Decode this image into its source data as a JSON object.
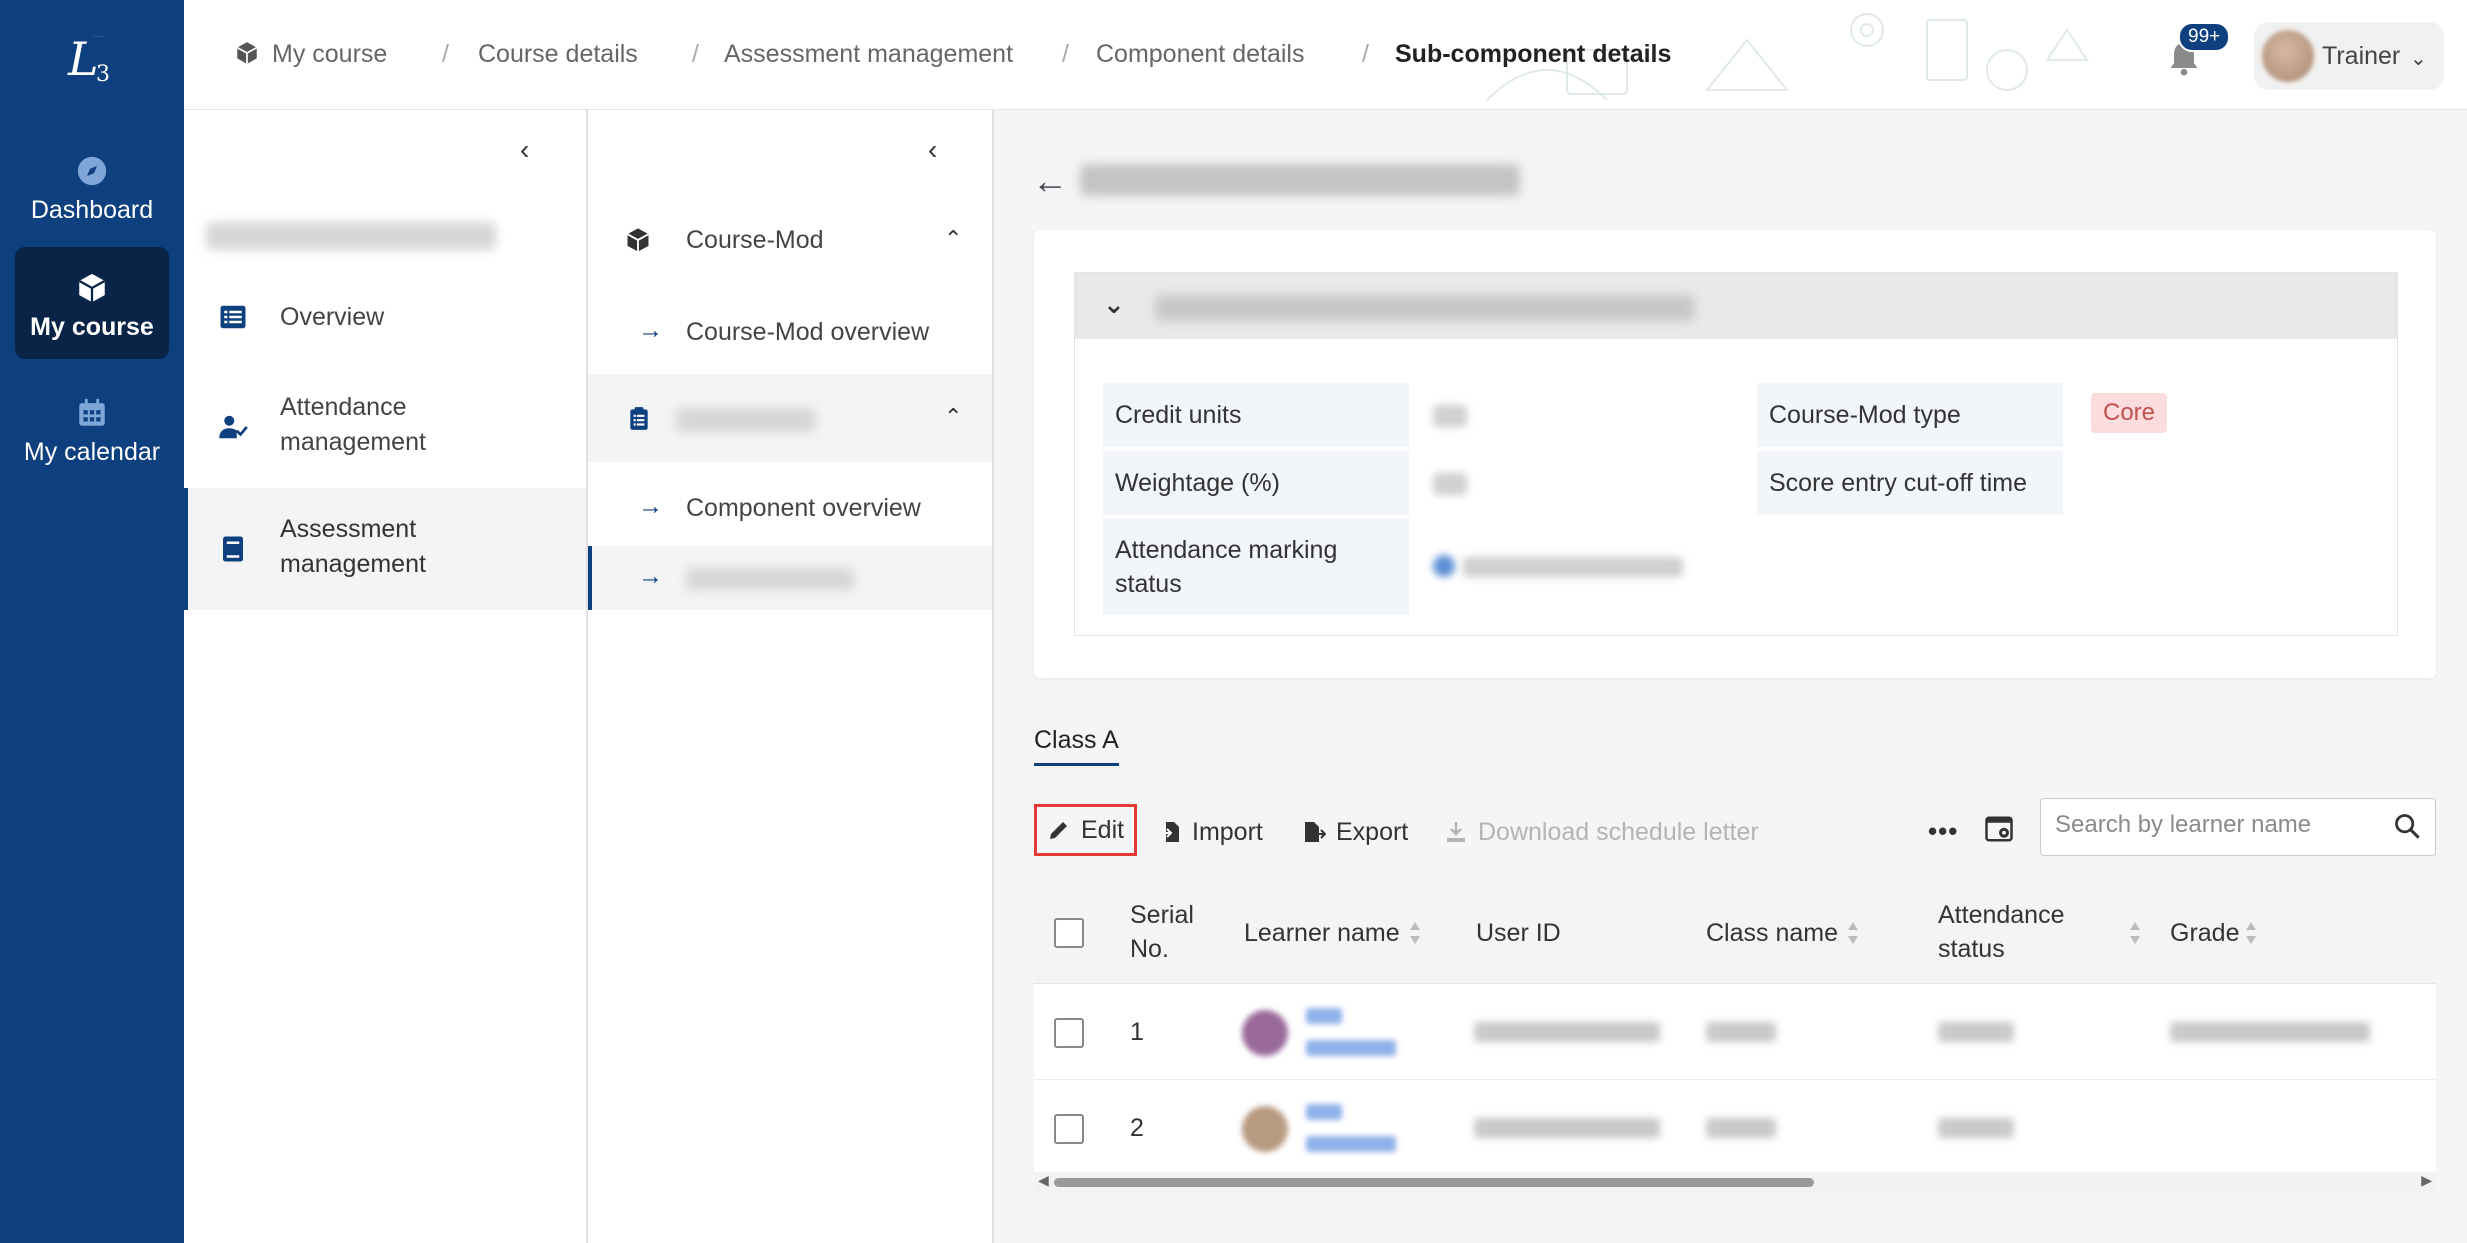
{
  "leftnav": {
    "items": [
      {
        "label": "Dashboard",
        "icon": "compass-icon"
      },
      {
        "label": "My course",
        "icon": "cube-icon"
      },
      {
        "label": "My calendar",
        "icon": "calendar-icon"
      }
    ]
  },
  "breadcrumb": {
    "items": [
      "My course",
      "Course details",
      "Assessment management",
      "Component details",
      "Sub-component details"
    ],
    "separator": "/"
  },
  "header": {
    "notification_badge": "99+",
    "username": "Trainer"
  },
  "panel1": {
    "items": [
      {
        "label": "Overview",
        "icon": "list-icon"
      },
      {
        "label": "Attendance management",
        "icon": "user-check-icon"
      },
      {
        "label": "Assessment management",
        "icon": "book-icon"
      }
    ]
  },
  "panel2": {
    "course_mod_label": "Course-Mod",
    "course_mod_overview": "Course-Mod overview",
    "component_overview": "Component overview"
  },
  "details": {
    "credit_units_label": "Credit units",
    "course_mod_type_label": "Course-Mod type",
    "course_mod_type_value": "Core",
    "weightage_label": "Weightage (%)",
    "score_cutoff_label": "Score entry cut-off time",
    "attendance_status_label": "Attendance marking status"
  },
  "tabs": [
    "Class A"
  ],
  "toolbar": {
    "edit": "Edit",
    "import": "Import",
    "export": "Export",
    "download": "Download schedule letter",
    "more": "•••"
  },
  "search": {
    "placeholder": "Search by learner name"
  },
  "table": {
    "headers": {
      "serial": "Serial No.",
      "learner": "Learner name",
      "userid": "User ID",
      "classname": "Class name",
      "attendance": "Attendance status",
      "grade": "Grade"
    },
    "rows": [
      {
        "serial": "1"
      },
      {
        "serial": "2"
      }
    ]
  },
  "colors": {
    "nav_bg": "#0e3f7e",
    "nav_active": "#0a2447",
    "tag_bg": "#fcdcdc",
    "tag_text": "#c0524f",
    "edit_highlight": "#e53935"
  }
}
